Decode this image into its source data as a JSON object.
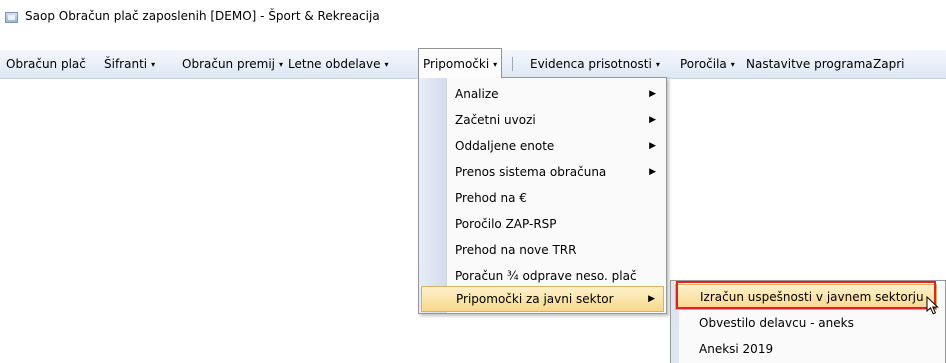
{
  "window": {
    "title": "Saop Obračun plač zaposlenih  [DEMO] - Šport & Rekreacija"
  },
  "menubar": {
    "items": [
      {
        "label": "Obračun plač",
        "has_arrow": false
      },
      {
        "label": "Šifranti",
        "has_arrow": true
      },
      {
        "label": "Obračun premij",
        "has_arrow": true
      },
      {
        "label": "Letne obdelave",
        "has_arrow": true
      },
      {
        "label": "Pripomočki",
        "has_arrow": true
      },
      {
        "label": "Evidenca prisotnosti",
        "has_arrow": true
      },
      {
        "label": "Poročila",
        "has_arrow": true
      },
      {
        "label": "Nastavitve programa",
        "has_arrow": false
      },
      {
        "label": "Zapri",
        "has_arrow": false
      }
    ],
    "arrow_glyph": "▾"
  },
  "dropdown": {
    "items": [
      {
        "label": "Analize",
        "submenu": true
      },
      {
        "label": "Začetni uvozi",
        "submenu": true
      },
      {
        "label": "Oddaljene enote",
        "submenu": true
      },
      {
        "label": "Prenos sistema obračuna",
        "submenu": true
      },
      {
        "label": "Prehod na €",
        "submenu": false
      },
      {
        "label": "Poročilo ZAP-RSP",
        "submenu": false
      },
      {
        "label": "Prehod na nove TRR",
        "submenu": false
      },
      {
        "label": "Poračun ¾ odprave neso. plač",
        "submenu": false
      },
      {
        "label": "Pripomočki za javni sektor",
        "submenu": true
      }
    ],
    "submenu_glyph": "▶"
  },
  "submenu": {
    "items": [
      {
        "label": "Izračun uspešnosti v javnem sektorju"
      },
      {
        "label": "Obvestilo delavcu - aneks"
      },
      {
        "label": "Aneksi 2019"
      }
    ]
  },
  "colors": {
    "highlight_border": "#e0202a",
    "menu_hover": "#f7d98c"
  }
}
